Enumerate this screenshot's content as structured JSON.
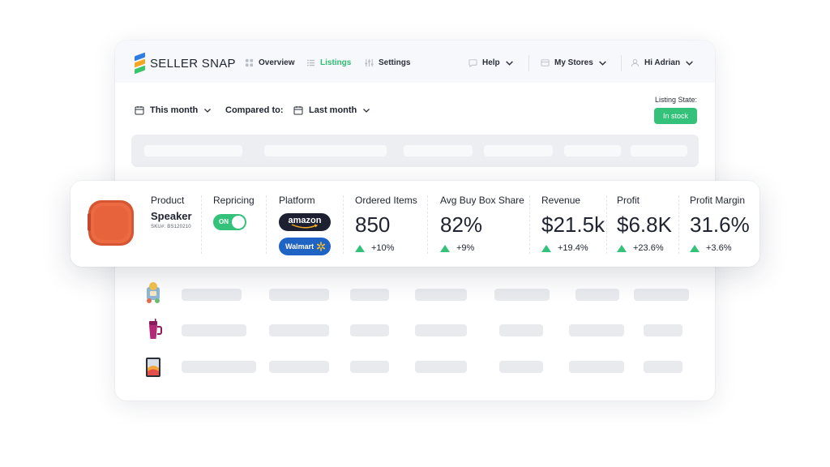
{
  "brand": {
    "name": "SELLER SNAP"
  },
  "nav": {
    "overview": "Overview",
    "listings": "Listings",
    "settings": "Settings",
    "help": "Help",
    "stores": "My Stores",
    "user": "Hi Adrian"
  },
  "filters": {
    "period": "This month",
    "compared_label": "Compared to:",
    "compare_period": "Last month"
  },
  "listing_state": {
    "label": "Listing State:",
    "value": "In stock"
  },
  "product": {
    "header": "Product",
    "name": "Speaker",
    "sku": "SKU#: BS120210"
  },
  "repricing": {
    "header": "Repricing",
    "toggle": "ON"
  },
  "platform": {
    "header": "Platform",
    "amazon": "amazon",
    "walmart": "Walmart"
  },
  "metrics": [
    {
      "header": "Ordered Items",
      "value": "850",
      "delta": "+10%"
    },
    {
      "header": "Avg Buy Box Share",
      "value": "82%",
      "delta": "+9%"
    },
    {
      "header": "Revenue",
      "value": "$21.5k",
      "delta": "+19.4%"
    },
    {
      "header": "Profit",
      "value": "$6.8K",
      "delta": "+23.6%"
    },
    {
      "header": "Profit Margin",
      "value": "31.6%",
      "delta": "+3.6%"
    }
  ],
  "colors": {
    "accent": "#34c27a",
    "amazon": "#1c2030",
    "walmart": "#1f63c5",
    "speaker": "#e8643a"
  },
  "icons": [
    "overview-grid-icon",
    "listings-list-icon",
    "settings-sliders-icon",
    "chat-bubble-icon",
    "store-icon",
    "user-icon",
    "calendar-icon",
    "chevron-down-icon",
    "trend-up-icon"
  ]
}
